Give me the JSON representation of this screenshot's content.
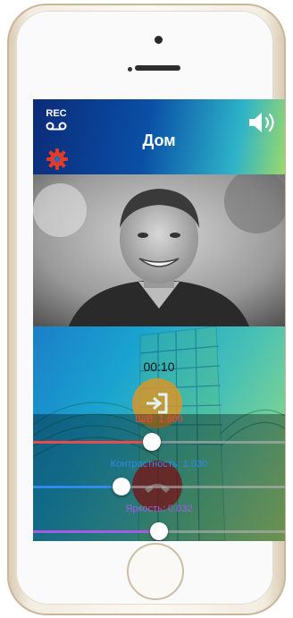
{
  "header": {
    "rec_label": "REC",
    "title": "Дом"
  },
  "call": {
    "timer": "00:10"
  },
  "sliders": [
    {
      "label": "Ш/В: 1.609",
      "value": 0.47,
      "color": "#e84b4b"
    },
    {
      "label": "Контрастность: 1.030",
      "value": 0.35,
      "color": "#2e8be8"
    },
    {
      "label": "Яркость: 0.032",
      "value": 0.5,
      "color": "#a35be0"
    }
  ],
  "colors": {
    "gear": "#e53a2a",
    "open_button": "#d9962a",
    "end_button": "#b81820"
  },
  "icons": {
    "rec": "voicemail-tape-icon",
    "settings": "gear-icon",
    "sound": "speaker-icon",
    "open": "door-open-icon",
    "end": "hang-up-icon"
  }
}
